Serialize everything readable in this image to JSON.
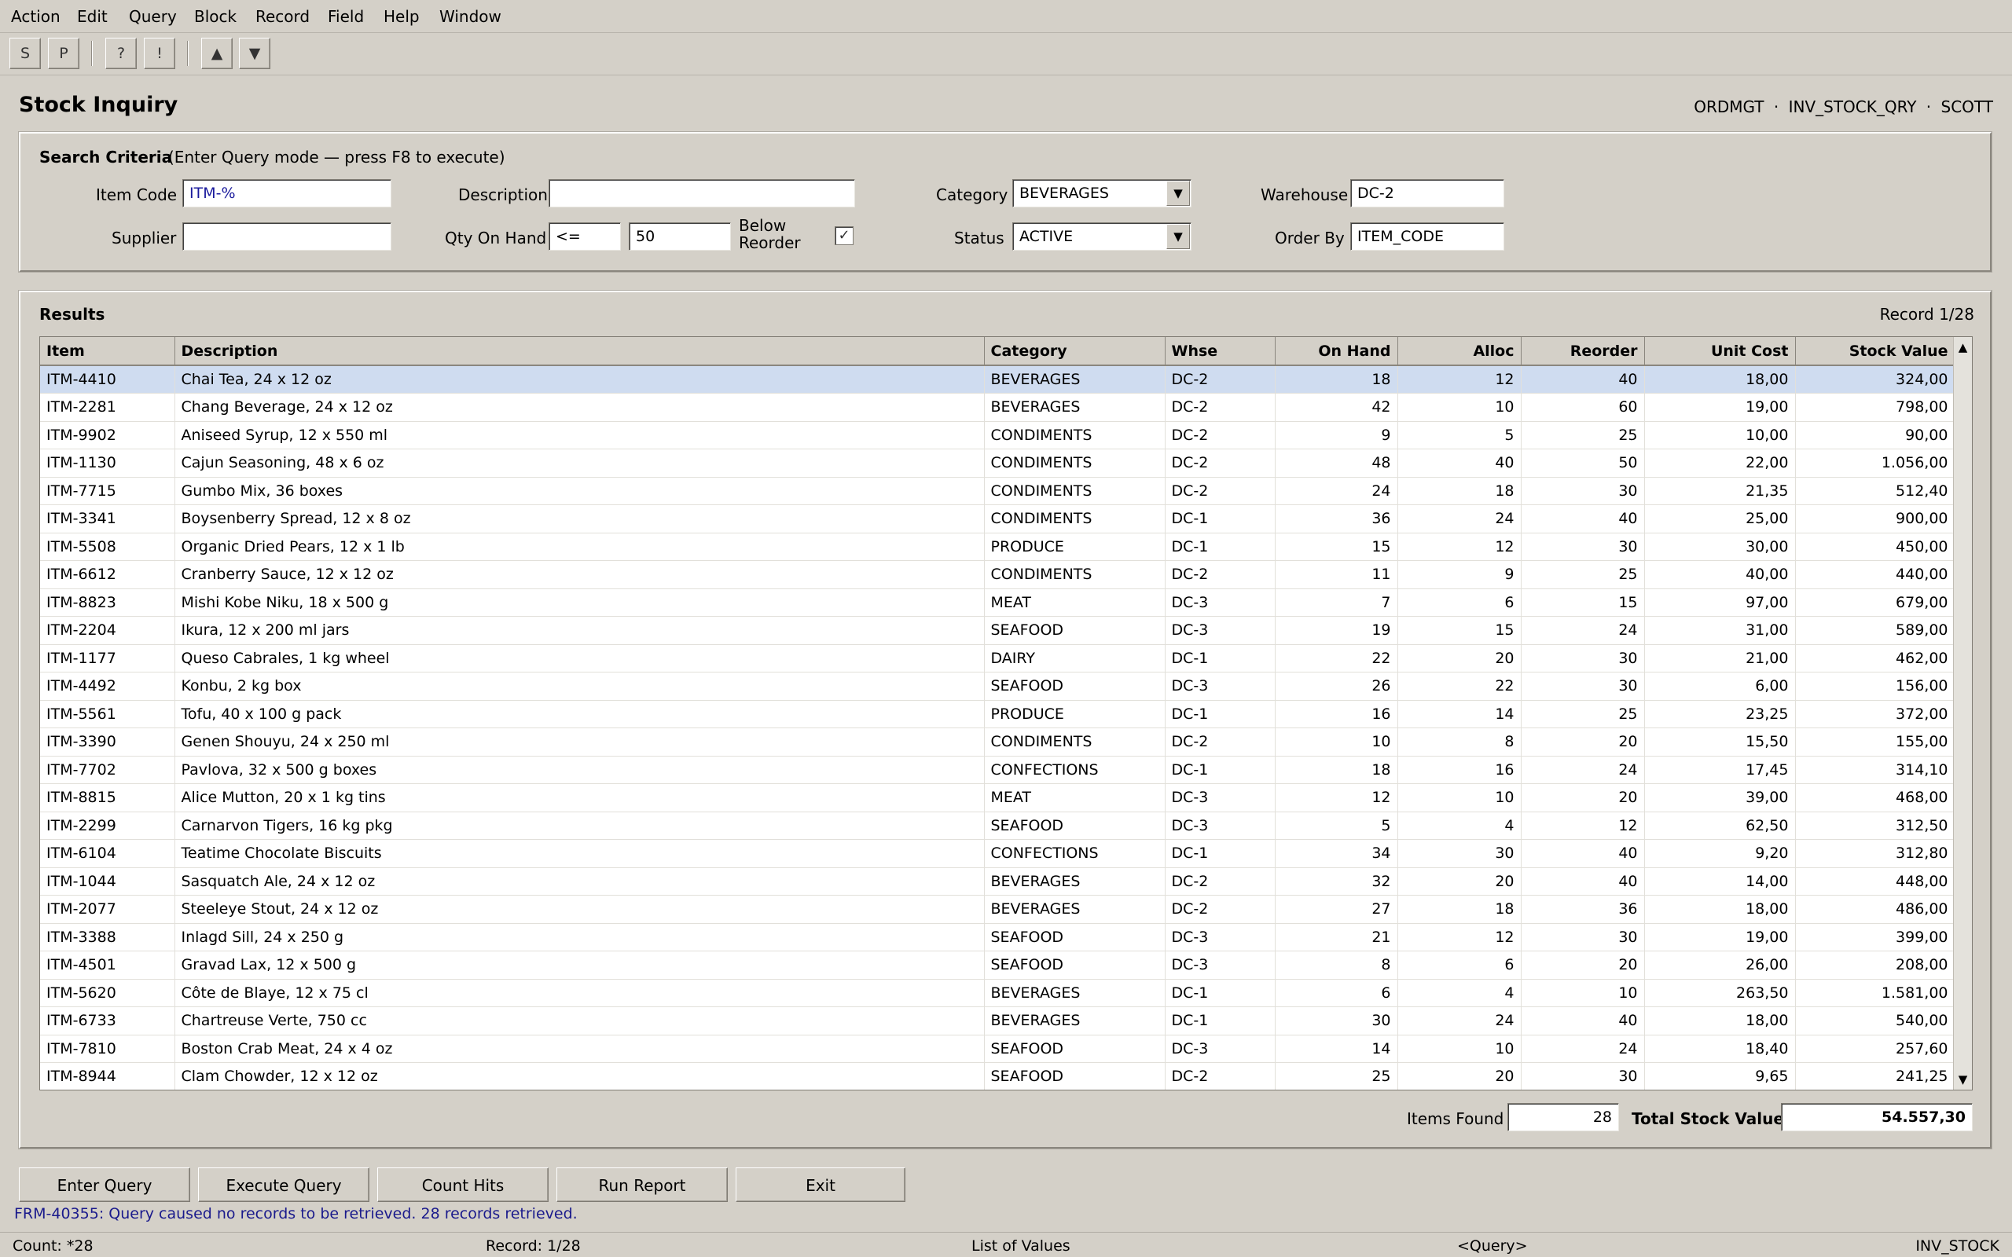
{
  "menu": [
    "Action",
    "Edit",
    "Query",
    "Block",
    "Record",
    "Field",
    "Help",
    "Window"
  ],
  "toolbar": {
    "save": "S",
    "print": "P",
    "help": "?",
    "alert": "!",
    "prev": "▲",
    "next": "▼"
  },
  "form": {
    "title": "Stock Inquiry",
    "context": [
      "ORDMGT",
      "·",
      "INV_STOCK_QRY",
      "·",
      "SCOTT"
    ]
  },
  "criteria": {
    "heading": "Search Criteria",
    "hint": "(Enter Query mode — press F8 to execute)",
    "item_code_label": "Item Code",
    "item_code_value": "ITM-%",
    "description_label": "Description",
    "description_value": "",
    "category_label": "Category",
    "category_value": "BEVERAGES",
    "warehouse_label": "Warehouse",
    "warehouse_value": "DC-2",
    "supplier_label": "Supplier",
    "supplier_value": "",
    "qty_label": "Qty On Hand",
    "qty_operator": "<=",
    "qty_value": "50",
    "below_reorder_label_1": "Below",
    "below_reorder_label_2": "Reorder",
    "below_reorder_checked": "✓",
    "status_label": "Status",
    "status_value": "ACTIVE",
    "order_by_label": "Order By",
    "order_by_value": "ITEM_CODE",
    "dropdown_icon": "▼"
  },
  "results": {
    "heading": "Results",
    "record_indicator": "Record 1/28",
    "columns": [
      "Item",
      "Description",
      "Category",
      "Whse",
      "On Hand",
      "Alloc",
      "Reorder",
      "Unit Cost",
      "Stock Value"
    ],
    "rows": [
      [
        "ITM-4410",
        "Chai Tea, 24 x 12 oz",
        "BEVERAGES",
        "DC-2",
        "18",
        "12",
        "40",
        "18,00",
        "324,00"
      ],
      [
        "ITM-2281",
        "Chang Beverage, 24 x 12 oz",
        "BEVERAGES",
        "DC-2",
        "42",
        "10",
        "60",
        "19,00",
        "798,00"
      ],
      [
        "ITM-9902",
        "Aniseed Syrup, 12 x 550 ml",
        "CONDIMENTS",
        "DC-2",
        "9",
        "5",
        "25",
        "10,00",
        "90,00"
      ],
      [
        "ITM-1130",
        "Cajun Seasoning, 48 x 6 oz",
        "CONDIMENTS",
        "DC-2",
        "48",
        "40",
        "50",
        "22,00",
        "1.056,00"
      ],
      [
        "ITM-7715",
        "Gumbo Mix, 36 boxes",
        "CONDIMENTS",
        "DC-2",
        "24",
        "18",
        "30",
        "21,35",
        "512,40"
      ],
      [
        "ITM-3341",
        "Boysenberry Spread, 12 x 8 oz",
        "CONDIMENTS",
        "DC-1",
        "36",
        "24",
        "40",
        "25,00",
        "900,00"
      ],
      [
        "ITM-5508",
        "Organic Dried Pears, 12 x 1 lb",
        "PRODUCE",
        "DC-1",
        "15",
        "12",
        "30",
        "30,00",
        "450,00"
      ],
      [
        "ITM-6612",
        "Cranberry Sauce, 12 x 12 oz",
        "CONDIMENTS",
        "DC-2",
        "11",
        "9",
        "25",
        "40,00",
        "440,00"
      ],
      [
        "ITM-8823",
        "Mishi Kobe Niku, 18 x 500 g",
        "MEAT",
        "DC-3",
        "7",
        "6",
        "15",
        "97,00",
        "679,00"
      ],
      [
        "ITM-2204",
        "Ikura, 12 x 200 ml jars",
        "SEAFOOD",
        "DC-3",
        "19",
        "15",
        "24",
        "31,00",
        "589,00"
      ],
      [
        "ITM-1177",
        "Queso Cabrales, 1 kg wheel",
        "DAIRY",
        "DC-1",
        "22",
        "20",
        "30",
        "21,00",
        "462,00"
      ],
      [
        "ITM-4492",
        "Konbu, 2 kg box",
        "SEAFOOD",
        "DC-3",
        "26",
        "22",
        "30",
        "6,00",
        "156,00"
      ],
      [
        "ITM-5561",
        "Tofu, 40 x 100 g pack",
        "PRODUCE",
        "DC-1",
        "16",
        "14",
        "25",
        "23,25",
        "372,00"
      ],
      [
        "ITM-3390",
        "Genen Shouyu, 24 x 250 ml",
        "CONDIMENTS",
        "DC-2",
        "10",
        "8",
        "20",
        "15,50",
        "155,00"
      ],
      [
        "ITM-7702",
        "Pavlova, 32 x 500 g boxes",
        "CONFECTIONS",
        "DC-1",
        "18",
        "16",
        "24",
        "17,45",
        "314,10"
      ],
      [
        "ITM-8815",
        "Alice Mutton, 20 x 1 kg tins",
        "MEAT",
        "DC-3",
        "12",
        "10",
        "20",
        "39,00",
        "468,00"
      ],
      [
        "ITM-2299",
        "Carnarvon Tigers, 16 kg pkg",
        "SEAFOOD",
        "DC-3",
        "5",
        "4",
        "12",
        "62,50",
        "312,50"
      ],
      [
        "ITM-6104",
        "Teatime Chocolate Biscuits",
        "CONFECTIONS",
        "DC-1",
        "34",
        "30",
        "40",
        "9,20",
        "312,80"
      ],
      [
        "ITM-1044",
        "Sasquatch Ale, 24 x 12 oz",
        "BEVERAGES",
        "DC-2",
        "32",
        "20",
        "40",
        "14,00",
        "448,00"
      ],
      [
        "ITM-2077",
        "Steeleye Stout, 24 x 12 oz",
        "BEVERAGES",
        "DC-2",
        "27",
        "18",
        "36",
        "18,00",
        "486,00"
      ],
      [
        "ITM-3388",
        "Inlagd Sill, 24 x 250 g",
        "SEAFOOD",
        "DC-3",
        "21",
        "12",
        "30",
        "19,00",
        "399,00"
      ],
      [
        "ITM-4501",
        "Gravad Lax, 12 x 500 g",
        "SEAFOOD",
        "DC-3",
        "8",
        "6",
        "20",
        "26,00",
        "208,00"
      ],
      [
        "ITM-5620",
        "Côte de Blaye, 12 x 75 cl",
        "BEVERAGES",
        "DC-1",
        "6",
        "4",
        "10",
        "263,50",
        "1.581,00"
      ],
      [
        "ITM-6733",
        "Chartreuse Verte, 750 cc",
        "BEVERAGES",
        "DC-1",
        "30",
        "24",
        "40",
        "18,00",
        "540,00"
      ],
      [
        "ITM-7810",
        "Boston Crab Meat, 24 x 4 oz",
        "SEAFOOD",
        "DC-3",
        "14",
        "10",
        "24",
        "18,40",
        "257,60"
      ],
      [
        "ITM-8944",
        "Clam Chowder, 12 x 12 oz",
        "SEAFOOD",
        "DC-2",
        "25",
        "20",
        "30",
        "9,65",
        "241,25"
      ]
    ],
    "scroll_up": "▲",
    "scroll_down": "▼",
    "items_found_label": "Items Found",
    "items_found_value": "28",
    "total_label": "Total Stock Value",
    "total_value": "54.557,30"
  },
  "buttons": {
    "enter_query": "Enter Query",
    "execute_query": "Execute Query",
    "count_hits": "Count Hits",
    "run_report": "Run Report",
    "exit": "Exit"
  },
  "message": "FRM-40355: Query caused no records to be retrieved. 28 records retrieved.",
  "status_bar": {
    "count": "Count: *28",
    "record": "Record: 1/28",
    "lov": "List of Values",
    "mode": "<Query>",
    "module": "INV_STOCK"
  },
  "colors": {
    "background": "#d4d0c8",
    "selected_row": "#cfdcf0",
    "message_text": "#1a1a8c"
  }
}
